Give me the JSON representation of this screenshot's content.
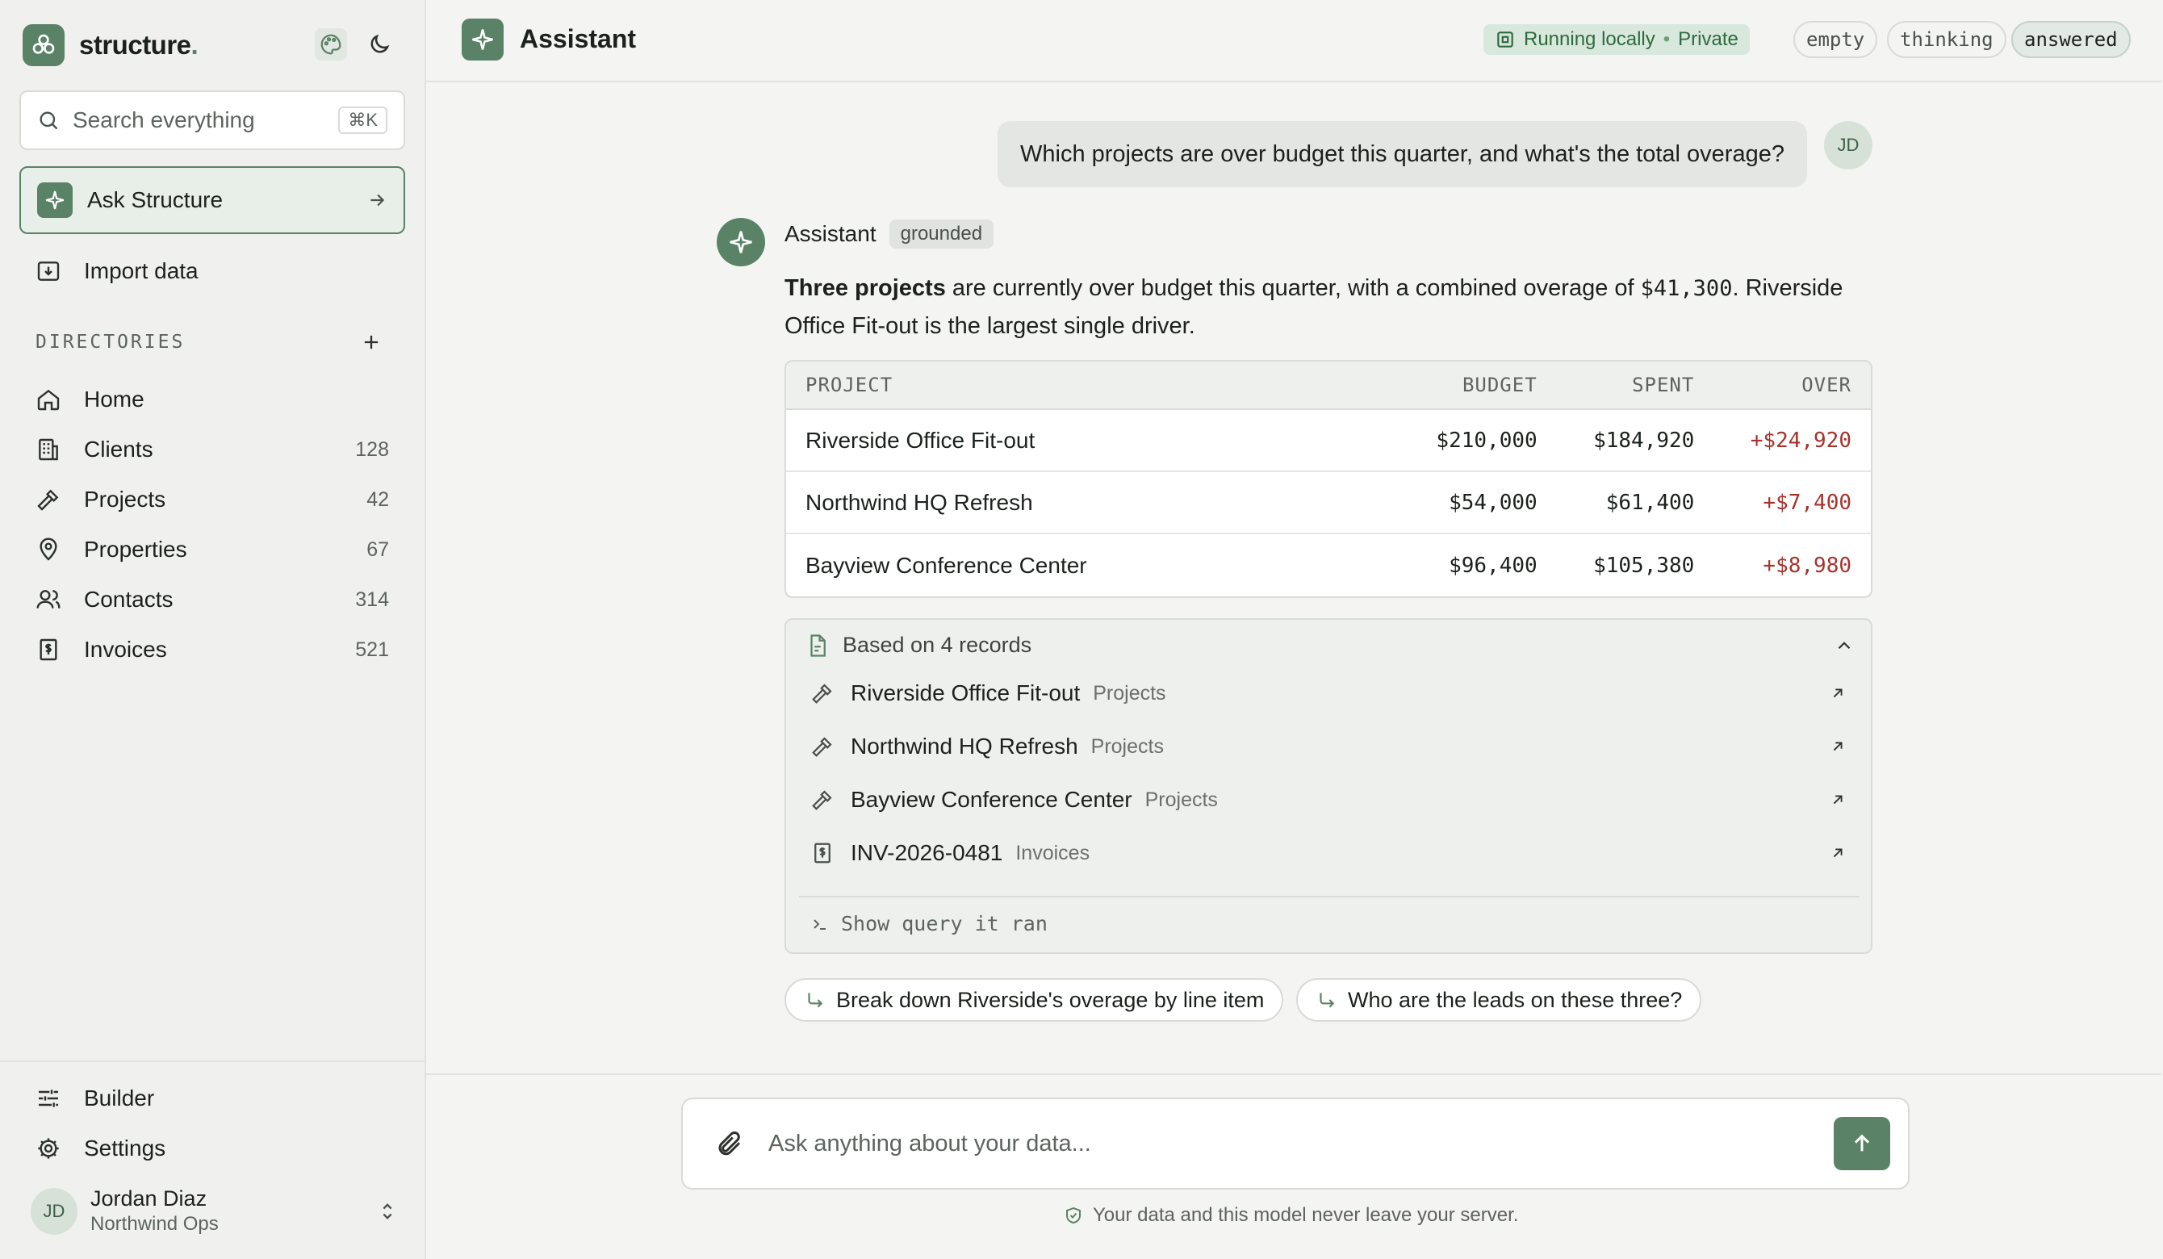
{
  "sidebar": {
    "brand_name": "structure",
    "brand_dot": ".",
    "search_placeholder": "Search everything",
    "search_shortcut": "⌘K",
    "ask_label": "Ask Structure",
    "import_label": "Import data",
    "directories_heading": "DIRECTORIES",
    "items": [
      {
        "label": "Home",
        "count": ""
      },
      {
        "label": "Clients",
        "count": "128"
      },
      {
        "label": "Projects",
        "count": "42"
      },
      {
        "label": "Properties",
        "count": "67"
      },
      {
        "label": "Contacts",
        "count": "314"
      },
      {
        "label": "Invoices",
        "count": "521"
      }
    ],
    "builder_label": "Builder",
    "settings_label": "Settings",
    "user": {
      "initials": "JD",
      "name": "Jordan Diaz",
      "org": "Northwind Ops"
    }
  },
  "header": {
    "title": "Assistant",
    "local_label": "Running locally",
    "private_label": "Private",
    "states": [
      "empty",
      "thinking",
      "answered"
    ],
    "active_state": "answered"
  },
  "chat": {
    "user_initials": "JD",
    "user_message": "Which projects are over budget this quarter, and what's the total overage?",
    "assistant_name": "Assistant",
    "assistant_tag": "grounded",
    "answer": {
      "bold": "Three projects",
      "text1": " are currently over budget this quarter, with a combined overage of ",
      "amount": "$41,300",
      "text2": ". Riverside Office Fit-out is the largest single driver."
    },
    "table": {
      "headers": [
        "PROJECT",
        "BUDGET",
        "SPENT",
        "OVER"
      ],
      "rows": [
        [
          "Riverside Office Fit-out",
          "$210,000",
          "$184,920",
          "+$24,920"
        ],
        [
          "Northwind HQ Refresh",
          "$54,000",
          "$61,400",
          "+$7,400"
        ],
        [
          "Bayview Conference Center",
          "$96,400",
          "$105,380",
          "+$8,980"
        ]
      ]
    },
    "records": {
      "title": "Based on 4 records",
      "items": [
        {
          "name": "Riverside Office Fit-out",
          "category": "Projects",
          "icon": "hammer-icon"
        },
        {
          "name": "Northwind HQ Refresh",
          "category": "Projects",
          "icon": "hammer-icon"
        },
        {
          "name": "Bayview Conference Center",
          "category": "Projects",
          "icon": "hammer-icon"
        },
        {
          "name": "INV-2026-0481",
          "category": "Invoices",
          "icon": "invoice-icon"
        }
      ],
      "query_label": "Show query it ran"
    },
    "suggestions": [
      "Break down Riverside's overage by line item",
      "Who are the leads on these three?"
    ]
  },
  "composer": {
    "placeholder": "Ask anything about your data...",
    "privacy_note": "Your data and this model never leave your server."
  },
  "colors": {
    "accent": "#5a8266",
    "over_budget": "#a8322c",
    "local_pill": "#d8e8dc"
  }
}
